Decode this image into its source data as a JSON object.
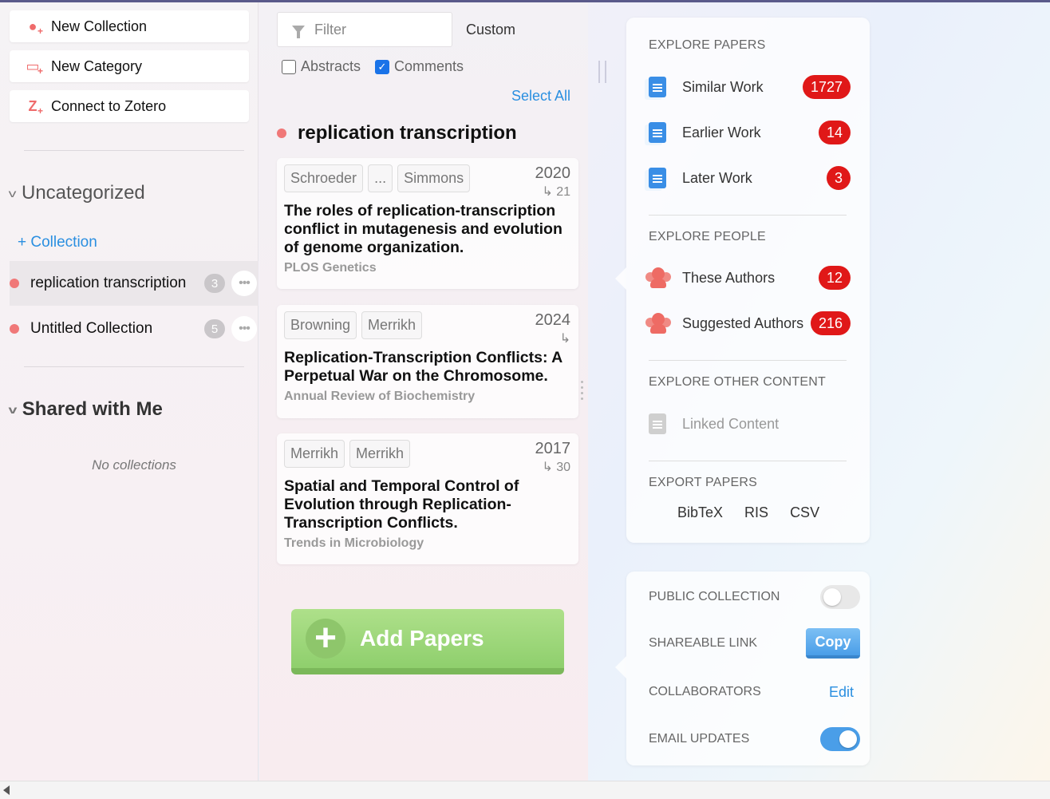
{
  "sidebar": {
    "buttons": [
      {
        "label": "New Collection",
        "icon": "new-collection-icon"
      },
      {
        "label": "New Category",
        "icon": "new-category-icon"
      },
      {
        "label": "Connect to Zotero",
        "icon": "zotero-icon"
      }
    ],
    "uncategorized": {
      "title": "Uncategorized",
      "add_label": "+ Collection",
      "collections": [
        {
          "name": "replication transcription",
          "count": "3"
        },
        {
          "name": "Untitled Collection",
          "count": "5"
        }
      ]
    },
    "shared": {
      "title": "Shared with Me",
      "empty_text": "No collections"
    }
  },
  "middle": {
    "filter_placeholder": "Filter",
    "sort_label": "Custom",
    "abstracts_label": "Abstracts",
    "comments_label": "Comments",
    "select_all": "Select All",
    "collection_title": "replication transcription",
    "papers": [
      {
        "authors": [
          "Schroeder",
          "...",
          "Simmons"
        ],
        "year": "2020",
        "cites": "↳ 21",
        "title": "The roles of replication-transcription conflict in mutagenesis and evolution of genome organization.",
        "journal": "PLOS Genetics"
      },
      {
        "authors": [
          "Browning",
          "Merrikh"
        ],
        "year": "2024",
        "cites": "↳",
        "title": "Replication-Transcription Conflicts: A Perpetual War on the Chromosome.",
        "journal": "Annual Review of Biochemistry"
      },
      {
        "authors": [
          "Merrikh",
          "Merrikh"
        ],
        "year": "2017",
        "cites": "↳ 30",
        "title": "Spatial and Temporal Control of Evolution through Replication-Transcription Conflicts.",
        "journal": "Trends in Microbiology"
      }
    ],
    "add_button": "Add Papers"
  },
  "explore": {
    "papers_head": "EXPLORE PAPERS",
    "similar": {
      "label": "Similar Work",
      "count": "1727"
    },
    "earlier": {
      "label": "Earlier Work",
      "count": "14"
    },
    "later": {
      "label": "Later Work",
      "count": "3"
    },
    "people_head": "EXPLORE PEOPLE",
    "these_authors": {
      "label": "These Authors",
      "count": "12"
    },
    "suggested_authors": {
      "label": "Suggested Authors",
      "count": "216"
    },
    "other_head": "EXPLORE OTHER CONTENT",
    "linked": {
      "label": "Linked Content"
    },
    "export_head": "EXPORT PAPERS",
    "export_options": [
      "BibTeX",
      "RIS",
      "CSV"
    ]
  },
  "settings": {
    "public_label": "PUBLIC COLLECTION",
    "public_on": false,
    "link_label": "SHAREABLE LINK",
    "copy_label": "Copy",
    "collab_label": "COLLABORATORS",
    "edit_label": "Edit",
    "email_label": "EMAIL UPDATES",
    "email_on": true
  },
  "colors": {
    "accent_blue": "#2a8fe0",
    "badge_red": "#e01818",
    "collection_dot": "#f07878",
    "add_green": "#8fcf6d"
  }
}
